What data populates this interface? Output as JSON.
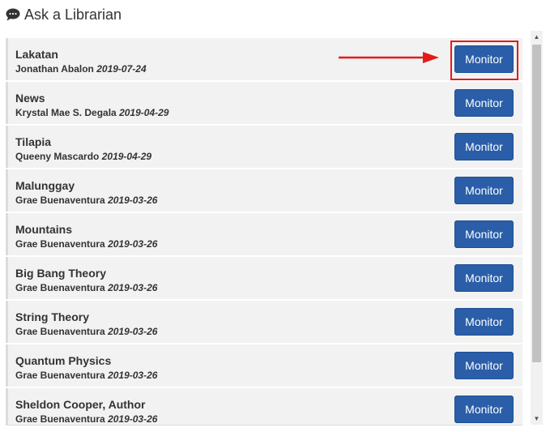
{
  "header": {
    "icon": "chat-icon",
    "title": "Ask a Librarian"
  },
  "items": [
    {
      "title": "Lakatan",
      "author": "Jonathan Abalon",
      "date": "2019-07-24",
      "button": "Monitor"
    },
    {
      "title": "News",
      "author": "Krystal Mae S. Degala",
      "date": "2019-04-29",
      "button": "Monitor"
    },
    {
      "title": "Tilapia",
      "author": "Queeny Mascardo",
      "date": "2019-04-29",
      "button": "Monitor"
    },
    {
      "title": "Malunggay",
      "author": "Grae Buenaventura",
      "date": "2019-03-26",
      "button": "Monitor"
    },
    {
      "title": "Mountains",
      "author": "Grae Buenaventura",
      "date": "2019-03-26",
      "button": "Monitor"
    },
    {
      "title": "Big Bang Theory",
      "author": "Grae Buenaventura",
      "date": "2019-03-26",
      "button": "Monitor"
    },
    {
      "title": "String Theory",
      "author": "Grae Buenaventura",
      "date": "2019-03-26",
      "button": "Monitor"
    },
    {
      "title": "Quantum Physics",
      "author": "Grae Buenaventura",
      "date": "2019-03-26",
      "button": "Monitor"
    },
    {
      "title": "Sheldon Cooper, Author",
      "author": "Grae Buenaventura",
      "date": "2019-03-26",
      "button": "Monitor"
    }
  ],
  "annotation": {
    "color": "#e41b1b"
  },
  "colors": {
    "button": "#2a5ea8",
    "item_bg": "#f2f2f2"
  }
}
